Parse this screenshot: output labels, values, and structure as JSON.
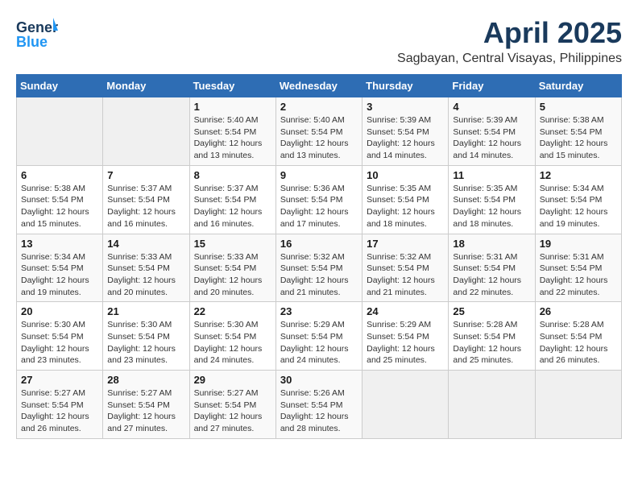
{
  "header": {
    "logo_line1": "General",
    "logo_line2": "Blue",
    "month_year": "April 2025",
    "location": "Sagbayan, Central Visayas, Philippines"
  },
  "weekdays": [
    "Sunday",
    "Monday",
    "Tuesday",
    "Wednesday",
    "Thursday",
    "Friday",
    "Saturday"
  ],
  "weeks": [
    [
      {
        "day": "",
        "info": ""
      },
      {
        "day": "",
        "info": ""
      },
      {
        "day": "1",
        "info": "Sunrise: 5:40 AM\nSunset: 5:54 PM\nDaylight: 12 hours\nand 13 minutes."
      },
      {
        "day": "2",
        "info": "Sunrise: 5:40 AM\nSunset: 5:54 PM\nDaylight: 12 hours\nand 13 minutes."
      },
      {
        "day": "3",
        "info": "Sunrise: 5:39 AM\nSunset: 5:54 PM\nDaylight: 12 hours\nand 14 minutes."
      },
      {
        "day": "4",
        "info": "Sunrise: 5:39 AM\nSunset: 5:54 PM\nDaylight: 12 hours\nand 14 minutes."
      },
      {
        "day": "5",
        "info": "Sunrise: 5:38 AM\nSunset: 5:54 PM\nDaylight: 12 hours\nand 15 minutes."
      }
    ],
    [
      {
        "day": "6",
        "info": "Sunrise: 5:38 AM\nSunset: 5:54 PM\nDaylight: 12 hours\nand 15 minutes."
      },
      {
        "day": "7",
        "info": "Sunrise: 5:37 AM\nSunset: 5:54 PM\nDaylight: 12 hours\nand 16 minutes."
      },
      {
        "day": "8",
        "info": "Sunrise: 5:37 AM\nSunset: 5:54 PM\nDaylight: 12 hours\nand 16 minutes."
      },
      {
        "day": "9",
        "info": "Sunrise: 5:36 AM\nSunset: 5:54 PM\nDaylight: 12 hours\nand 17 minutes."
      },
      {
        "day": "10",
        "info": "Sunrise: 5:35 AM\nSunset: 5:54 PM\nDaylight: 12 hours\nand 18 minutes."
      },
      {
        "day": "11",
        "info": "Sunrise: 5:35 AM\nSunset: 5:54 PM\nDaylight: 12 hours\nand 18 minutes."
      },
      {
        "day": "12",
        "info": "Sunrise: 5:34 AM\nSunset: 5:54 PM\nDaylight: 12 hours\nand 19 minutes."
      }
    ],
    [
      {
        "day": "13",
        "info": "Sunrise: 5:34 AM\nSunset: 5:54 PM\nDaylight: 12 hours\nand 19 minutes."
      },
      {
        "day": "14",
        "info": "Sunrise: 5:33 AM\nSunset: 5:54 PM\nDaylight: 12 hours\nand 20 minutes."
      },
      {
        "day": "15",
        "info": "Sunrise: 5:33 AM\nSunset: 5:54 PM\nDaylight: 12 hours\nand 20 minutes."
      },
      {
        "day": "16",
        "info": "Sunrise: 5:32 AM\nSunset: 5:54 PM\nDaylight: 12 hours\nand 21 minutes."
      },
      {
        "day": "17",
        "info": "Sunrise: 5:32 AM\nSunset: 5:54 PM\nDaylight: 12 hours\nand 21 minutes."
      },
      {
        "day": "18",
        "info": "Sunrise: 5:31 AM\nSunset: 5:54 PM\nDaylight: 12 hours\nand 22 minutes."
      },
      {
        "day": "19",
        "info": "Sunrise: 5:31 AM\nSunset: 5:54 PM\nDaylight: 12 hours\nand 22 minutes."
      }
    ],
    [
      {
        "day": "20",
        "info": "Sunrise: 5:30 AM\nSunset: 5:54 PM\nDaylight: 12 hours\nand 23 minutes."
      },
      {
        "day": "21",
        "info": "Sunrise: 5:30 AM\nSunset: 5:54 PM\nDaylight: 12 hours\nand 23 minutes."
      },
      {
        "day": "22",
        "info": "Sunrise: 5:30 AM\nSunset: 5:54 PM\nDaylight: 12 hours\nand 24 minutes."
      },
      {
        "day": "23",
        "info": "Sunrise: 5:29 AM\nSunset: 5:54 PM\nDaylight: 12 hours\nand 24 minutes."
      },
      {
        "day": "24",
        "info": "Sunrise: 5:29 AM\nSunset: 5:54 PM\nDaylight: 12 hours\nand 25 minutes."
      },
      {
        "day": "25",
        "info": "Sunrise: 5:28 AM\nSunset: 5:54 PM\nDaylight: 12 hours\nand 25 minutes."
      },
      {
        "day": "26",
        "info": "Sunrise: 5:28 AM\nSunset: 5:54 PM\nDaylight: 12 hours\nand 26 minutes."
      }
    ],
    [
      {
        "day": "27",
        "info": "Sunrise: 5:27 AM\nSunset: 5:54 PM\nDaylight: 12 hours\nand 26 minutes."
      },
      {
        "day": "28",
        "info": "Sunrise: 5:27 AM\nSunset: 5:54 PM\nDaylight: 12 hours\nand 27 minutes."
      },
      {
        "day": "29",
        "info": "Sunrise: 5:27 AM\nSunset: 5:54 PM\nDaylight: 12 hours\nand 27 minutes."
      },
      {
        "day": "30",
        "info": "Sunrise: 5:26 AM\nSunset: 5:54 PM\nDaylight: 12 hours\nand 28 minutes."
      },
      {
        "day": "",
        "info": ""
      },
      {
        "day": "",
        "info": ""
      },
      {
        "day": "",
        "info": ""
      }
    ]
  ]
}
